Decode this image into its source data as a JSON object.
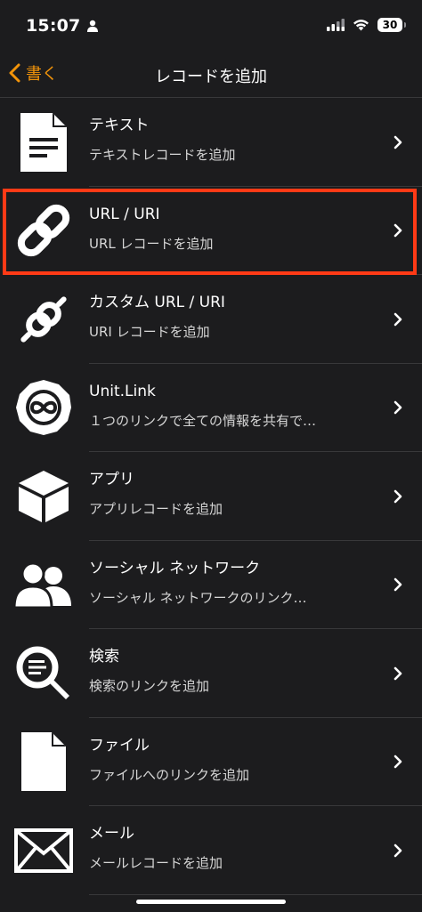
{
  "status_bar": {
    "time": "15:07",
    "battery": "30"
  },
  "nav": {
    "back_label": "書く",
    "title": "レコードを追加"
  },
  "items": [
    {
      "title": "テキスト",
      "subtitle": "テキストレコードを追加",
      "icon": "document-text-icon"
    },
    {
      "title": "URL / URI",
      "subtitle": "URL レコードを追加",
      "icon": "link-icon"
    },
    {
      "title": "カスタム URL / URI",
      "subtitle": "URI レコードを追加",
      "icon": "broken-link-icon"
    },
    {
      "title": "Unit.Link",
      "subtitle": "１つのリンクで全ての情報を共有で…",
      "icon": "unit-link-icon"
    },
    {
      "title": "アプリ",
      "subtitle": "アプリレコードを追加",
      "icon": "box-icon"
    },
    {
      "title": "ソーシャル ネットワーク",
      "subtitle": "ソーシャル ネットワークのリンク…",
      "icon": "people-icon"
    },
    {
      "title": "検索",
      "subtitle": "検索のリンクを追加",
      "icon": "search-icon"
    },
    {
      "title": "ファイル",
      "subtitle": "ファイルへのリンクを追加",
      "icon": "file-icon"
    },
    {
      "title": "メール",
      "subtitle": "メールレコードを追加",
      "icon": "mail-icon"
    }
  ],
  "colors": {
    "accent": "#f2940a",
    "highlight": "#ff3a16",
    "background": "#1c1c1e"
  }
}
